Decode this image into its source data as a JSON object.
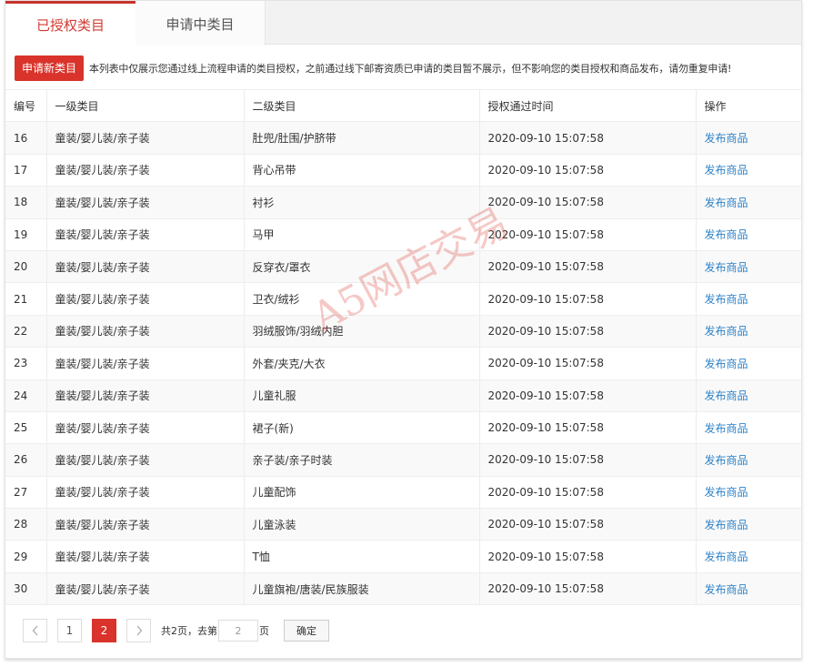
{
  "tabs": [
    {
      "label": "已授权类目",
      "active": true
    },
    {
      "label": "申请中类目",
      "active": false
    }
  ],
  "notice": {
    "button_label": "申请新类目",
    "text": "本列表中仅展示您通过线上流程申请的类目授权，之前通过线下邮寄资质已申请的类目暂不展示，但不影响您的类目授权和商品发布，请勿重复申请!"
  },
  "table": {
    "headers": [
      "编号",
      "一级类目",
      "二级类目",
      "授权通过时间",
      "操作"
    ],
    "rows": [
      {
        "id": "16",
        "cat1": "童装/婴儿装/亲子装",
        "cat2": "肚兜/肚围/护脐带",
        "time": "2020-09-10 15:07:58",
        "action": "发布商品"
      },
      {
        "id": "17",
        "cat1": "童装/婴儿装/亲子装",
        "cat2": "背心吊带",
        "time": "2020-09-10 15:07:58",
        "action": "发布商品"
      },
      {
        "id": "18",
        "cat1": "童装/婴儿装/亲子装",
        "cat2": "衬衫",
        "time": "2020-09-10 15:07:58",
        "action": "发布商品"
      },
      {
        "id": "19",
        "cat1": "童装/婴儿装/亲子装",
        "cat2": "马甲",
        "time": "2020-09-10 15:07:58",
        "action": "发布商品"
      },
      {
        "id": "20",
        "cat1": "童装/婴儿装/亲子装",
        "cat2": "反穿衣/罩衣",
        "time": "2020-09-10 15:07:58",
        "action": "发布商品"
      },
      {
        "id": "21",
        "cat1": "童装/婴儿装/亲子装",
        "cat2": "卫衣/绒衫",
        "time": "2020-09-10 15:07:58",
        "action": "发布商品"
      },
      {
        "id": "22",
        "cat1": "童装/婴儿装/亲子装",
        "cat2": "羽绒服饰/羽绒内胆",
        "time": "2020-09-10 15:07:58",
        "action": "发布商品"
      },
      {
        "id": "23",
        "cat1": "童装/婴儿装/亲子装",
        "cat2": "外套/夹克/大衣",
        "time": "2020-09-10 15:07:58",
        "action": "发布商品"
      },
      {
        "id": "24",
        "cat1": "童装/婴儿装/亲子装",
        "cat2": "儿童礼服",
        "time": "2020-09-10 15:07:58",
        "action": "发布商品"
      },
      {
        "id": "25",
        "cat1": "童装/婴儿装/亲子装",
        "cat2": "裙子(新)",
        "time": "2020-09-10 15:07:58",
        "action": "发布商品"
      },
      {
        "id": "26",
        "cat1": "童装/婴儿装/亲子装",
        "cat2": "亲子装/亲子时装",
        "time": "2020-09-10 15:07:58",
        "action": "发布商品"
      },
      {
        "id": "27",
        "cat1": "童装/婴儿装/亲子装",
        "cat2": "儿童配饰",
        "time": "2020-09-10 15:07:58",
        "action": "发布商品"
      },
      {
        "id": "28",
        "cat1": "童装/婴儿装/亲子装",
        "cat2": "儿童泳装",
        "time": "2020-09-10 15:07:58",
        "action": "发布商品"
      },
      {
        "id": "29",
        "cat1": "童装/婴儿装/亲子装",
        "cat2": "T恤",
        "time": "2020-09-10 15:07:58",
        "action": "发布商品"
      },
      {
        "id": "30",
        "cat1": "童装/婴儿装/亲子装",
        "cat2": "儿童旗袍/唐装/民族服装",
        "time": "2020-09-10 15:07:58",
        "action": "发布商品"
      }
    ]
  },
  "pagination": {
    "prev_icon": "chevron-left-icon",
    "next_icon": "chevron-right-icon",
    "pages": [
      "1",
      "2"
    ],
    "current_page": "2",
    "total_text": "共2页，去第",
    "goto_value": "2",
    "page_suffix": "页",
    "confirm_label": "确定"
  },
  "watermark": "A5网店交易",
  "colors": {
    "accent": "#d9332b",
    "link": "#2e82c8"
  }
}
